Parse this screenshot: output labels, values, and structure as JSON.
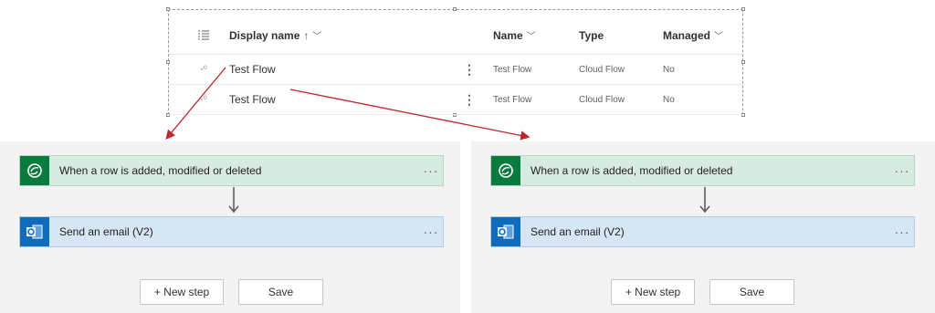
{
  "table": {
    "columns": {
      "display_name": "Display name",
      "display_sort": "↑",
      "name": "Name",
      "type": "Type",
      "managed": "Managed"
    },
    "rows": [
      {
        "display_name": "Test Flow",
        "name": "Test Flow",
        "type": "Cloud Flow",
        "managed": "No"
      },
      {
        "display_name": "Test Flow",
        "name": "Test Flow",
        "type": "Cloud Flow",
        "managed": "No"
      }
    ]
  },
  "flow_left": {
    "trigger": {
      "title": "When a row is added, modified or deleted",
      "menu": "···"
    },
    "action": {
      "title": "Send an email (V2)",
      "menu": "···"
    },
    "new_step": "+ New step",
    "save": "Save"
  },
  "flow_right": {
    "trigger": {
      "title": "When a row is added, modified or deleted",
      "menu": "···"
    },
    "action": {
      "title": "Send an email (V2)",
      "menu": "···"
    },
    "new_step": "+ New step",
    "save": "Save"
  },
  "icons": {
    "column_options": "list-icon",
    "flow_row": "flow-icon",
    "dataverse": "dataverse-icon",
    "outlook": "outlook-icon"
  },
  "colors": {
    "trigger_bg": "#d7ebe0",
    "trigger_icon": "#0a7b3e",
    "action_bg": "#d7e6f4",
    "action_icon": "#0f6cbd",
    "arrow": "#c0262a"
  }
}
